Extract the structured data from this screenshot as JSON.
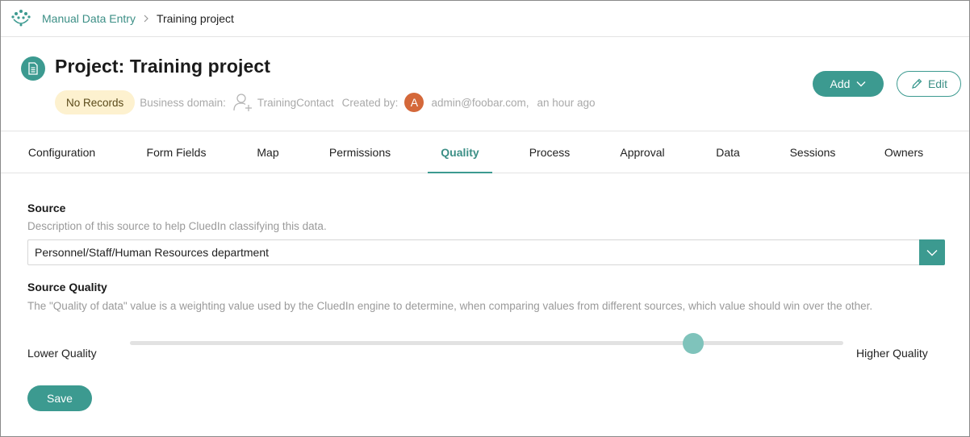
{
  "breadcrumb": {
    "parent": "Manual Data Entry",
    "current": "Training project"
  },
  "header": {
    "title": "Project: Training project",
    "status_badge": "No Records",
    "business_domain_label": "Business domain:",
    "business_domain_value": "TrainingContact",
    "created_by_label": "Created by:",
    "avatar_initial": "A",
    "created_by_email": "admin@foobar.com,",
    "created_time": "an hour ago",
    "add_label": "Add",
    "edit_label": "Edit"
  },
  "tabs": [
    {
      "label": "Configuration",
      "active": false
    },
    {
      "label": "Form Fields",
      "active": false
    },
    {
      "label": "Map",
      "active": false
    },
    {
      "label": "Permissions",
      "active": false
    },
    {
      "label": "Quality",
      "active": true
    },
    {
      "label": "Process",
      "active": false
    },
    {
      "label": "Approval",
      "active": false
    },
    {
      "label": "Data",
      "active": false
    },
    {
      "label": "Sessions",
      "active": false
    },
    {
      "label": "Owners",
      "active": false
    }
  ],
  "source": {
    "title": "Source",
    "description": "Description of this source to help CluedIn classifying this data.",
    "selected_value": "Personnel/Staff/Human Resources department"
  },
  "source_quality": {
    "title": "Source Quality",
    "description": "The \"Quality of data\" value is a weighting value used by the CluedIn engine to determine, when comparing values from different sources, which value should win over the other.",
    "lower_label": "Lower Quality",
    "higher_label": "Higher Quality",
    "slider_fraction": 0.79
  },
  "save_label": "Save",
  "colors": {
    "accent": "#3c9a90",
    "slider_thumb": "#7fc3bb",
    "badge_bg": "#fdf1cf",
    "avatar": "#d4683a"
  }
}
